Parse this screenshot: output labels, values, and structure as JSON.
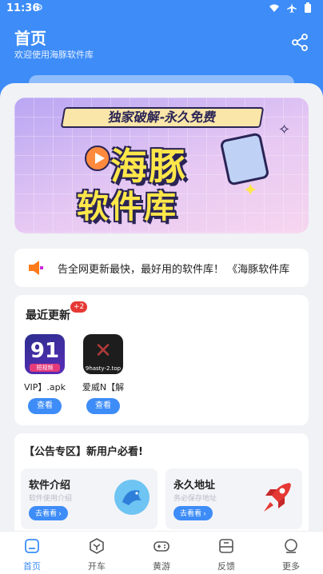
{
  "status_bar": {
    "time": "11:36"
  },
  "header": {
    "title": "首页",
    "subtitle": "欢迎使用海豚软件库"
  },
  "banner": {
    "ribbon_text": "独家破解-永久免费",
    "line1": "海豚",
    "line2": "软件库"
  },
  "notice": {
    "text": "告全网更新最快，最好用的软件库！ 《海豚软件库"
  },
  "recent": {
    "title": "最近更新",
    "badge": "+2",
    "apps": [
      {
        "icon_text": "91",
        "icon_sub": "短视频",
        "name": "VIP】.apk",
        "button": "查看"
      },
      {
        "icon_text": "✕",
        "icon_sub": "9hasty-2.top",
        "name": "爱威N【解",
        "button": "查看"
      }
    ]
  },
  "announcement": {
    "title": "【公告专区】新用户必看!",
    "cards": [
      {
        "title": "软件介绍",
        "desc": "软件使用介绍",
        "button": "去看看 ›"
      },
      {
        "title": "永久地址",
        "desc": "务必保存地址",
        "button": "去看看 ›"
      }
    ]
  },
  "bottom_nav": [
    {
      "label": "首页",
      "active": true
    },
    {
      "label": "开车",
      "active": false
    },
    {
      "label": "黄游",
      "active": false
    },
    {
      "label": "反馈",
      "active": false
    },
    {
      "label": "更多",
      "active": false
    }
  ],
  "colors": {
    "primary": "#3d8cf7",
    "badge": "#e53935",
    "banner_text": "#ffe74a"
  }
}
